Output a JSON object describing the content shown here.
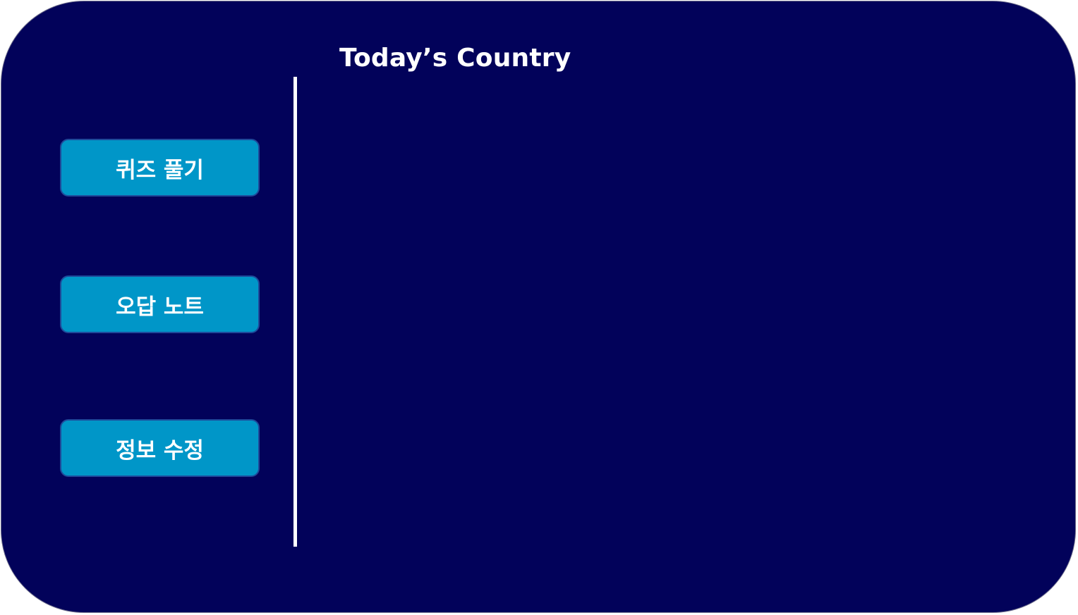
{
  "header": {
    "title": "Today’s Country"
  },
  "menu": {
    "items": [
      {
        "label": "퀴즈 풀기"
      },
      {
        "label": "오답 노트"
      },
      {
        "label": "정보 수정"
      }
    ]
  },
  "colors": {
    "background": "#02025a",
    "button": "#0096c8",
    "button_border": "#1e4a9a",
    "text": "#ffffff"
  }
}
